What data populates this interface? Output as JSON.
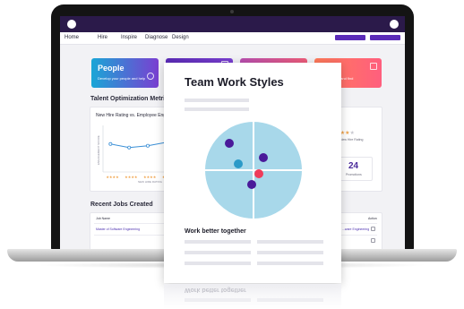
{
  "nav": {
    "items": [
      "Home",
      "Hire",
      "Inspire",
      "Diagnose",
      "Design"
    ]
  },
  "cards": [
    {
      "title": "People",
      "subtitle": "Develop your people and help",
      "gradient": [
        "#1aa6d6",
        "#7a3fd1"
      ]
    },
    {
      "title": "",
      "subtitle": "",
      "gradient": [
        "#5b2bb8",
        "#7a3fd1"
      ]
    },
    {
      "title": "",
      "subtitle": "",
      "gradient": [
        "#b94fb0",
        "#ef5c7a"
      ]
    },
    {
      "title": "",
      "subtitle": "...n jobs and find",
      "gradient": [
        "#ff7a59",
        "#ff5f7e"
      ]
    }
  ],
  "metrics": {
    "section_title": "Talent Optimization Metrics",
    "chart_title": "New Hire Rating vs. Employee Engage",
    "y_label": "ENGAGEMENT SCORE",
    "x_label": "NEW HIRE RATING",
    "rating_label": "Average New Hire Rating",
    "promotions_value": "24",
    "promotions_label": "Promotions"
  },
  "chart_data": {
    "type": "line",
    "x": [
      1,
      2,
      3,
      4,
      5
    ],
    "y": [
      2.4,
      2.1,
      2.25,
      2.55,
      2.9
    ],
    "xlim": [
      0.6,
      5.4
    ],
    "ylim": [
      0,
      4
    ]
  },
  "jobs": {
    "section_title": "Recent Jobs Created",
    "col_job_name": "Job Name",
    "col_action": "Action",
    "row1_job": "Master of Software Engineering",
    "row1_right": "...ware Engineering"
  },
  "document": {
    "title": "Team Work Styles",
    "subtitle": "Work better together",
    "reflection_text": "Work better together"
  },
  "colors": {
    "accent": "#5b2bb8",
    "topbar": "#2b1a4a",
    "quadrant": "#a8d8ea",
    "dot_purple": "#4a1a9a",
    "dot_blue": "#2b9ac8",
    "dot_red": "#ef3c5a"
  }
}
